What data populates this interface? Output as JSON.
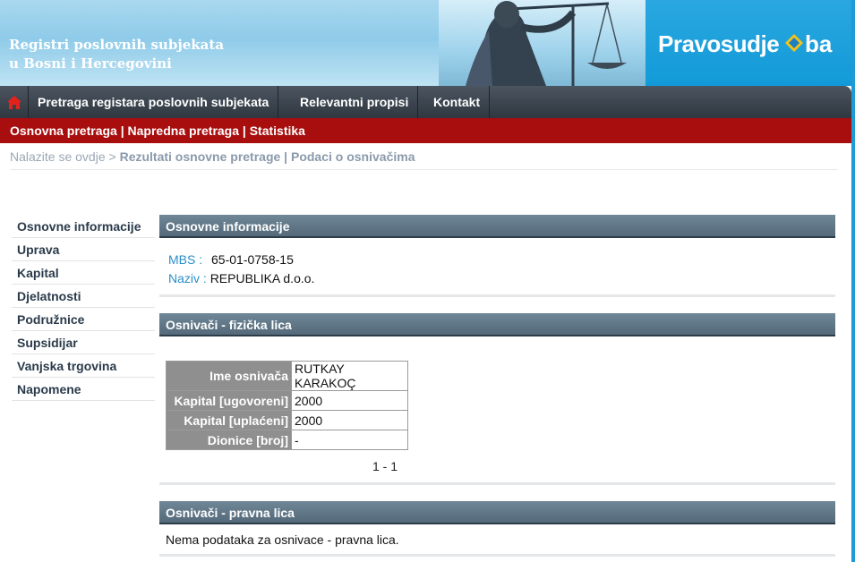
{
  "header": {
    "title_line1": "Registri poslovnih subjekata",
    "title_line2": "u Bosni i Hercegovini",
    "logo_text_left": "Pravosudje",
    "logo_text_right": "ba"
  },
  "nav": {
    "items": [
      {
        "label": "Pretraga registara poslovnih subjekata"
      },
      {
        "label": "Relevantni propisi"
      },
      {
        "label": "Kontakt"
      }
    ]
  },
  "subnav": {
    "links": [
      "Osnovna pretraga",
      "Napredna pretraga",
      "Statistika"
    ],
    "separator": " | "
  },
  "breadcrumb": {
    "prefix": "Nalazite se ovdje >",
    "current": "Rezultati osnovne pretrage | Podaci o osnivačima"
  },
  "sidebar": {
    "items": [
      {
        "label": "Osnovne informacije"
      },
      {
        "label": "Uprava"
      },
      {
        "label": "Kapital"
      },
      {
        "label": "Djelatnosti"
      },
      {
        "label": "Podružnice"
      },
      {
        "label": "Supsidijar"
      },
      {
        "label": "Vanjska trgovina"
      },
      {
        "label": "Napomene"
      }
    ]
  },
  "basic_info": {
    "heading": "Osnovne informacije",
    "mbs_label": "MBS :",
    "mbs_value": "65-01-0758-15",
    "name_label": "Naziv :",
    "name_value": "REPUBLIKA d.o.o."
  },
  "founders_physical": {
    "heading": "Osnivači - fizička lica",
    "rows": [
      {
        "label": "Ime osnivača",
        "value": "RUTKAY KARAKOÇ"
      },
      {
        "label": "Kapital [ugovoreni]",
        "value": "2000"
      },
      {
        "label": "Kapital [uplaćeni]",
        "value": "2000"
      },
      {
        "label": "Dionice [broj]",
        "value": "-"
      }
    ],
    "pager": "1 - 1"
  },
  "founders_legal": {
    "heading": "Osnivači - pravna lica",
    "no_data": "Nema podataka za osnivace - pravna lica."
  },
  "colors": {
    "nav_bg": "#3a434c",
    "subnav_bg": "#a80e0e",
    "panel_header": "#5f7585",
    "label_blue": "#2a8fc9",
    "logo_blue": "#129ad8"
  }
}
